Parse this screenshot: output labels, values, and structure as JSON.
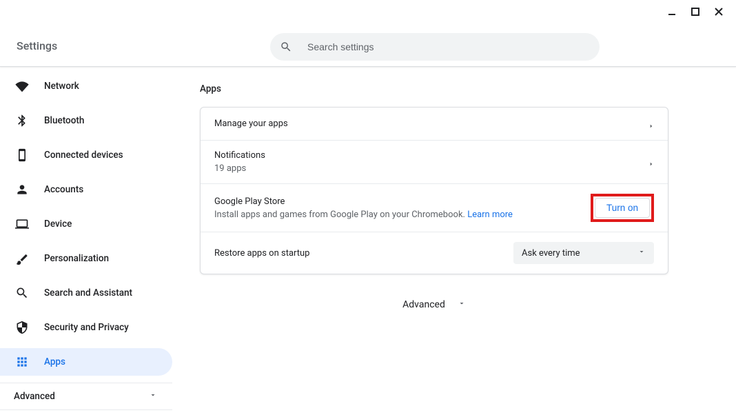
{
  "header": {
    "title": "Settings",
    "search_placeholder": "Search settings"
  },
  "sidebar": {
    "items": [
      {
        "label": "Network"
      },
      {
        "label": "Bluetooth"
      },
      {
        "label": "Connected devices"
      },
      {
        "label": "Accounts"
      },
      {
        "label": "Device"
      },
      {
        "label": "Personalization"
      },
      {
        "label": "Search and Assistant"
      },
      {
        "label": "Security and Privacy"
      },
      {
        "label": "Apps"
      }
    ],
    "advanced_label": "Advanced"
  },
  "main": {
    "section_title": "Apps",
    "rows": {
      "manage": {
        "primary": "Manage your apps"
      },
      "notifications": {
        "primary": "Notifications",
        "secondary": "19 apps"
      },
      "play": {
        "primary": "Google Play Store",
        "secondary_prefix": "Install apps and games from Google Play on your Chromebook. ",
        "learn_more": "Learn more",
        "button": "Turn on"
      },
      "restore": {
        "primary": "Restore apps on startup",
        "selected": "Ask every time"
      }
    },
    "advanced_label": "Advanced"
  }
}
